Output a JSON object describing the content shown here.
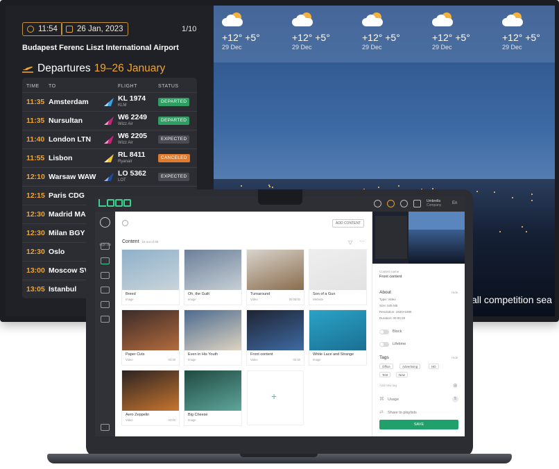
{
  "tv": {
    "time": "11:54",
    "date": "26 Jan, 2023",
    "page_count": "1/10",
    "airport": "Budapest Ferenc Liszt International Airport",
    "departures_title": "Departures",
    "departures_dates": "19–26 January",
    "columns": [
      "TIME",
      "TO",
      "FLIGHT",
      "STATUS"
    ],
    "flights": [
      {
        "time": "11:35",
        "to": "Amsterdam",
        "flight": "KL 1974",
        "airline": "KLM",
        "status": "DEPARTED",
        "status_color": "#2e9e63",
        "logo_color": "#3aa0e0"
      },
      {
        "time": "11:35",
        "to": "Nursultan",
        "flight": "W6 2249",
        "airline": "Wizz Air",
        "status": "DEPARTED",
        "status_color": "#2e9e63",
        "logo_color": "#c6237d"
      },
      {
        "time": "11:40",
        "to": "London LTN",
        "flight": "W6 2205",
        "airline": "Wizz Air",
        "status": "EXPECTED",
        "status_color": "#4a4b52",
        "logo_color": "#c6237d"
      },
      {
        "time": "11:55",
        "to": "Lisbon",
        "flight": "RL 8411",
        "airline": "Ryanair",
        "status": "CANCELED",
        "status_color": "#e27a2e",
        "logo_color": "#f2c230"
      },
      {
        "time": "12:10",
        "to": "Warsaw WAW",
        "flight": "LO 5362",
        "airline": "LOT",
        "status": "EXPECTED",
        "status_color": "#4a4b52",
        "logo_color": "#1e4c9c"
      },
      {
        "time": "12:15",
        "to": "Paris CDG",
        "flight": "",
        "airline": "",
        "status": "",
        "status_color": "",
        "logo_color": ""
      },
      {
        "time": "12:30",
        "to": "Madrid MAD",
        "flight": "",
        "airline": "",
        "status": "",
        "status_color": "",
        "logo_color": ""
      },
      {
        "time": "12:30",
        "to": "Milan BGY",
        "flight": "",
        "airline": "",
        "status": "",
        "status_color": "",
        "logo_color": ""
      },
      {
        "time": "12:30",
        "to": "Oslo",
        "flight": "",
        "airline": "",
        "status": "",
        "status_color": "",
        "logo_color": ""
      },
      {
        "time": "13:00",
        "to": "Moscow SVO",
        "flight": "",
        "airline": "",
        "status": "",
        "status_color": "",
        "logo_color": ""
      },
      {
        "time": "13:05",
        "to": "Istanbul",
        "flight": "",
        "airline": "",
        "status": "",
        "status_color": "",
        "logo_color": ""
      }
    ],
    "weather": [
      {
        "temp": "+12° +5°",
        "date": "29 Dec"
      },
      {
        "temp": "+12° +5°",
        "date": "29 Dec"
      },
      {
        "temp": "+12° +5°",
        "date": "29 Dec"
      },
      {
        "temp": "+12° +5°",
        "date": "29 Dec"
      },
      {
        "temp": "+12° +5°",
        "date": "29 Dec"
      }
    ],
    "ticker": "all competition sea"
  },
  "app": {
    "logo": "LOOK",
    "company_name": "Umbrella",
    "company_label": "Company",
    "language": "En",
    "sign_out": "Sign out",
    "add_content": "ADD CONTENT",
    "content_title": "Content",
    "content_count": "16 out of 68",
    "cards": [
      {
        "title": "Breed",
        "type": "Image",
        "duration": "",
        "c1": "#8fb0c9",
        "c2": "#c9d4db"
      },
      {
        "title": "Oh, the Guilt",
        "type": "Image",
        "duration": "",
        "c1": "#6c8099",
        "c2": "#c6cfd6"
      },
      {
        "title": "Turnaround",
        "type": "Video",
        "duration": "00:05:00",
        "c1": "#d8d4cc",
        "c2": "#8a6c4d"
      },
      {
        "title": "Son of a Gun",
        "type": "Website",
        "duration": "",
        "c1": "#eeeeee",
        "c2": "#e2e2e2"
      },
      {
        "title": "Paper Cuts",
        "type": "Video",
        "duration": "04:30",
        "c1": "#3b2b2a",
        "c2": "#b46b3c"
      },
      {
        "title": "Even in His Youth",
        "type": "Image",
        "duration": "",
        "c1": "#4c6b8f",
        "c2": "#ded3c1"
      },
      {
        "title": "Front content",
        "type": "Video",
        "duration": "02:40",
        "c1": "#1f2433",
        "c2": "#3e6aa3"
      },
      {
        "title": "White Lace and Strange",
        "type": "Image",
        "duration": "",
        "c1": "#2aa3c6",
        "c2": "#1b6f93"
      },
      {
        "title": "Aero Zeppelin",
        "type": "Video",
        "duration": "02:00",
        "c1": "#2c2322",
        "c2": "#c7752f"
      },
      {
        "title": "Big Cheese",
        "type": "Image",
        "duration": "",
        "c1": "#1f4a40",
        "c2": "#5fa59b"
      }
    ],
    "panel": {
      "content_name_label": "Content name",
      "content_name": "Front content",
      "about": "About",
      "hide": "Hide",
      "type": "Type: Video",
      "size": "Size: 545 Mb",
      "resolution": "Resolution: 1920×1080",
      "duration": "Duration: 00:00:28",
      "block": "Block",
      "lifetime": "Lifetime",
      "tags_title": "Tags",
      "tags": [
        "Office",
        "Advertising",
        "HD",
        "Test",
        "New"
      ],
      "add_tag": "Add new tag",
      "usage": "Usage",
      "usage_count": "5",
      "share": "Share to playlists",
      "save": "SAVE"
    }
  }
}
